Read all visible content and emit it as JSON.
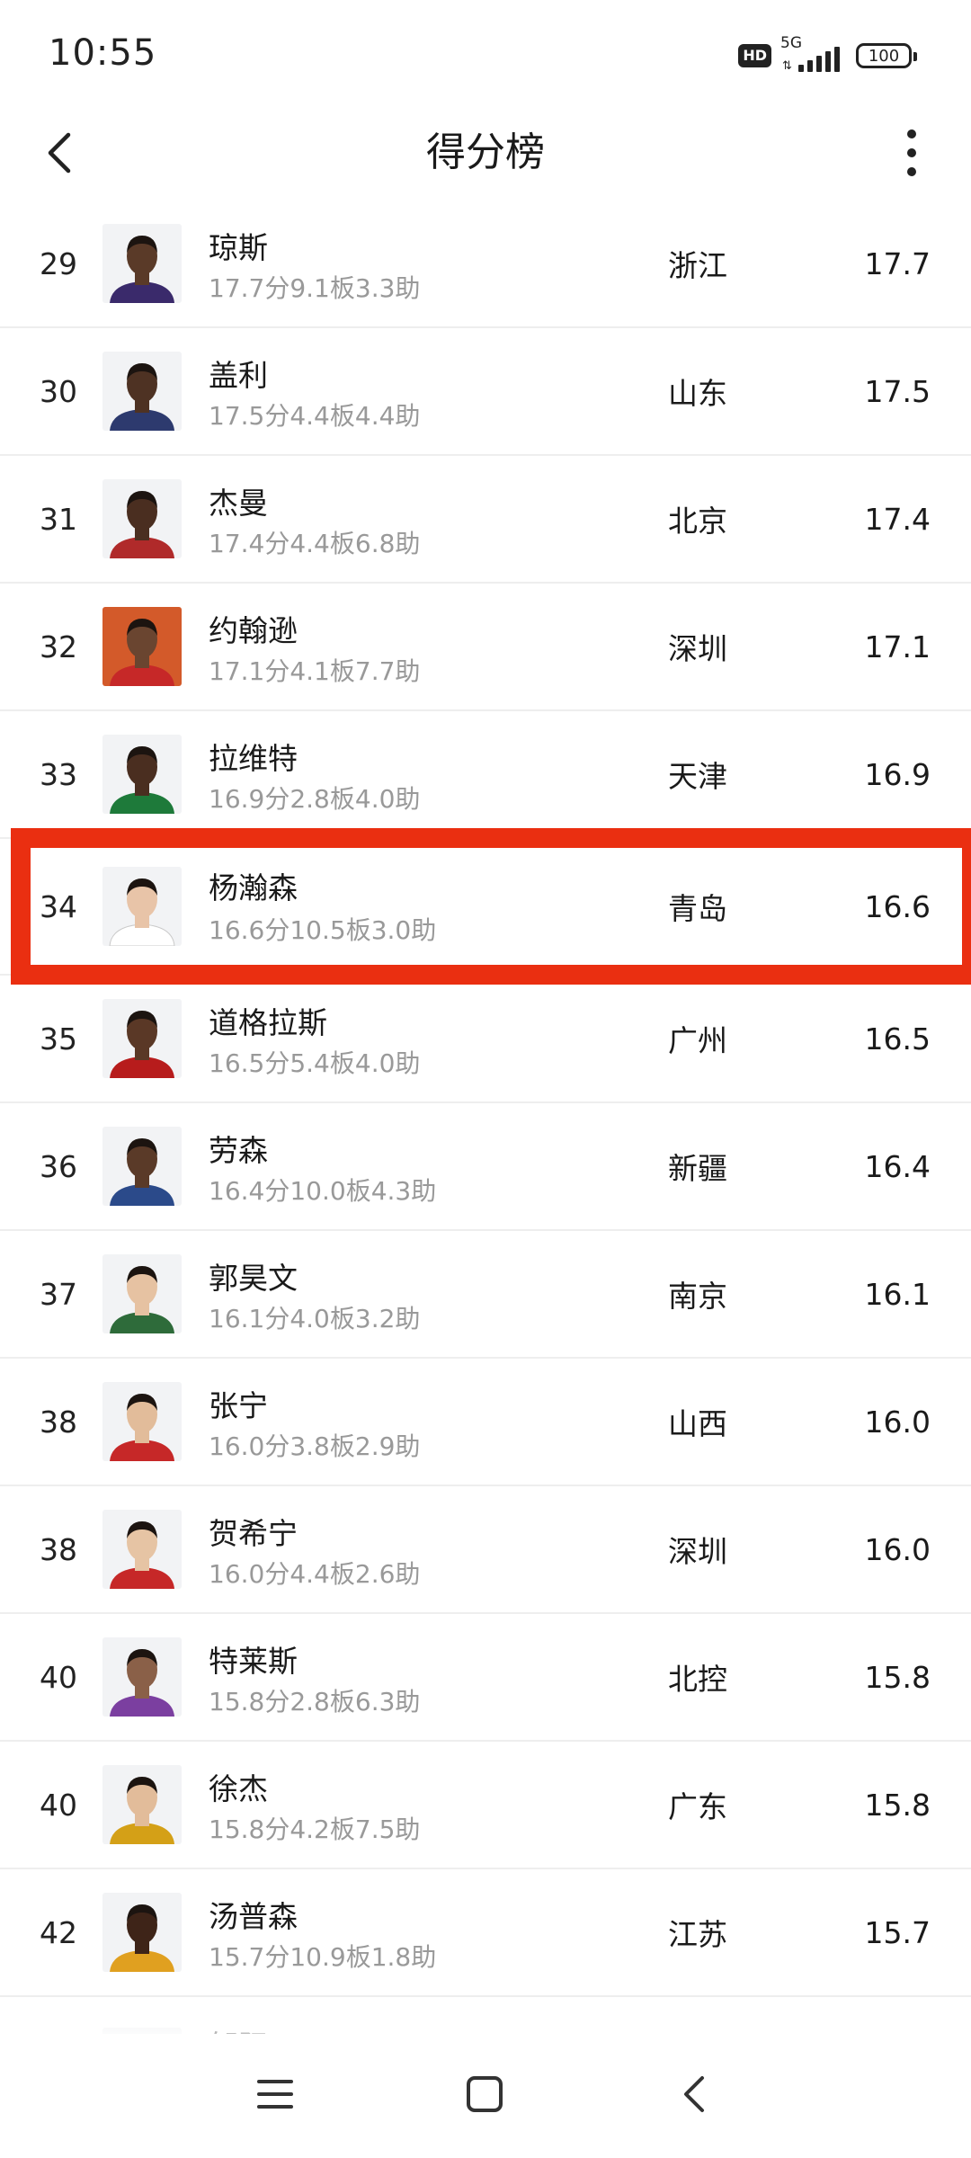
{
  "status_bar": {
    "time": "10:55",
    "hd": "HD",
    "network": "5G",
    "battery": "100"
  },
  "header": {
    "title": "得分榜",
    "back_icon": "chevron-left-icon",
    "more_icon": "more-vertical-icon"
  },
  "players": [
    {
      "rank": "29",
      "name": "琼斯",
      "stats": "17.7分9.1板3.3助",
      "team": "浙江",
      "score": "17.7",
      "jersey_color": "#3a2a6b",
      "skin": "#5a3a28"
    },
    {
      "rank": "30",
      "name": "盖利",
      "stats": "17.5分4.4板4.4助",
      "team": "山东",
      "score": "17.5",
      "jersey_color": "#2d3a6e",
      "skin": "#4e3223"
    },
    {
      "rank": "31",
      "name": "杰曼",
      "stats": "17.4分4.4板6.8助",
      "team": "北京",
      "score": "17.4",
      "jersey_color": "#b02a2a",
      "skin": "#4a2e20"
    },
    {
      "rank": "32",
      "name": "约翰逊",
      "stats": "17.1分4.1板7.7助",
      "team": "深圳",
      "score": "17.1",
      "jersey_color": "#c62828",
      "skin": "#6a4530"
    },
    {
      "rank": "33",
      "name": "拉维特",
      "stats": "16.9分2.8板4.0助",
      "team": "天津",
      "score": "16.9",
      "jersey_color": "#1e7a3a",
      "skin": "#4a2e20"
    },
    {
      "rank": "34",
      "name": "杨瀚森",
      "stats": "16.6分10.5板3.0助",
      "team": "青岛",
      "score": "16.6",
      "jersey_color": "#ffffff",
      "skin": "#e8c4a8",
      "highlighted": true
    },
    {
      "rank": "35",
      "name": "道格拉斯",
      "stats": "16.5分5.4板4.0助",
      "team": "广州",
      "score": "16.5",
      "jersey_color": "#b71c1c",
      "skin": "#5a3826"
    },
    {
      "rank": "36",
      "name": "劳森",
      "stats": "16.4分10.0板4.3助",
      "team": "新疆",
      "score": "16.4",
      "jersey_color": "#2b4a8a",
      "skin": "#5a3a28"
    },
    {
      "rank": "37",
      "name": "郭昊文",
      "stats": "16.1分4.0板3.2助",
      "team": "南京",
      "score": "16.1",
      "jersey_color": "#2e6b3a",
      "skin": "#e6c2a2"
    },
    {
      "rank": "38",
      "name": "张宁",
      "stats": "16.0分3.8板2.9助",
      "team": "山西",
      "score": "16.0",
      "jersey_color": "#c62828",
      "skin": "#e2bc9a"
    },
    {
      "rank": "38",
      "name": "贺希宁",
      "stats": "16.0分4.4板2.6助",
      "team": "深圳",
      "score": "16.0",
      "jersey_color": "#c62828",
      "skin": "#e6c4a4"
    },
    {
      "rank": "40",
      "name": "特莱斯",
      "stats": "15.8分2.8板6.3助",
      "team": "北控",
      "score": "15.8",
      "jersey_color": "#7b3fa0",
      "skin": "#8a6048"
    },
    {
      "rank": "40",
      "name": "徐杰",
      "stats": "15.8分4.2板7.5助",
      "team": "广东",
      "score": "15.8",
      "jersey_color": "#d4a017",
      "skin": "#e2bc9a"
    },
    {
      "rank": "42",
      "name": "汤普森",
      "stats": "15.7分10.9板1.8助",
      "team": "江苏",
      "score": "15.7",
      "jersey_color": "#e0a020",
      "skin": "#3e2418"
    }
  ],
  "partial_row": {
    "name": "邹阳"
  },
  "highlight_color": "#ea2f11",
  "navbar": {
    "menu_icon": "menu-icon",
    "home_icon": "home-square-icon",
    "back_icon": "back-triangle-icon"
  }
}
